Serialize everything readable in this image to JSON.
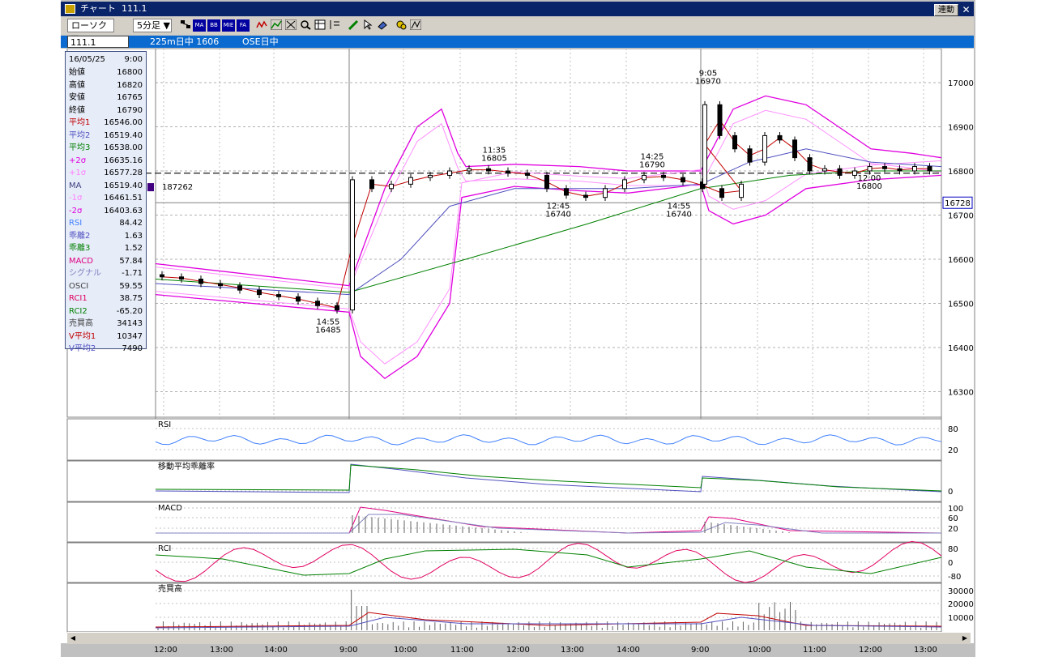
{
  "window": {
    "title": "チャート",
    "code_title": "111.1",
    "linked_button": "連動",
    "close_button": "✕"
  },
  "toolbar": {
    "chart_type": "ローソク ▼",
    "interval": "5分足 ▼",
    "icons": [
      "list-icon",
      "ma-icon",
      "bb-icon",
      "mie-icon",
      "fa-icon",
      "wave-icon",
      "trend-icon",
      "cursor-icon",
      "zoom-icon",
      "table-icon",
      "pen-icon",
      "pointer-icon",
      "eraser-icon",
      "tool-icon",
      "draw-icon"
    ],
    "labels": {
      "ma": "MA",
      "bb": "BB",
      "mie": "MIE",
      "fa": "FA"
    }
  },
  "infobar": {
    "code": "111.1",
    "name": "225m日中 1606",
    "session": "OSE日中"
  },
  "info_panel": {
    "date": "16/05/25",
    "time": "9:00",
    "rows": [
      {
        "label": "始値",
        "value": "16800",
        "color": "#000000"
      },
      {
        "label": "高値",
        "value": "16820",
        "color": "#000000"
      },
      {
        "label": "安値",
        "value": "16765",
        "color": "#000000"
      },
      {
        "label": "終値",
        "value": "16790",
        "color": "#000000"
      },
      {
        "label": "平均1",
        "value": "16546.00",
        "color": "#c00000"
      },
      {
        "label": "平均2",
        "value": "16519.40",
        "color": "#5050c0"
      },
      {
        "label": "平均3",
        "value": "16538.00",
        "color": "#008000"
      },
      {
        "label": "+2σ",
        "value": "16635.16",
        "color": "#e000e0"
      },
      {
        "label": "+1σ",
        "value": "16577.28",
        "color": "#ff80ff"
      },
      {
        "label": "MA",
        "value": "16519.40",
        "color": "#404080"
      },
      {
        "label": "-1σ",
        "value": "16461.51",
        "color": "#ff80ff"
      },
      {
        "label": "-2σ",
        "value": "16403.63",
        "color": "#e000e0"
      },
      {
        "label": "RSI",
        "value": "84.42",
        "color": "#4080ff"
      },
      {
        "label": "乖離2",
        "value": "1.63",
        "color": "#5050c0"
      },
      {
        "label": "乖離3",
        "value": "1.52",
        "color": "#008000"
      },
      {
        "label": "MACD",
        "value": "57.84",
        "color": "#e00080"
      },
      {
        "label": "シグナル",
        "value": "-1.71",
        "color": "#8080c0"
      },
      {
        "label": "OSCI",
        "value": "59.55",
        "color": "#404040"
      },
      {
        "label": "RCI1",
        "value": "38.75",
        "color": "#e00060"
      },
      {
        "label": "RCI2",
        "value": "-65.20",
        "color": "#008000"
      },
      {
        "label": "売買高",
        "value": "34143",
        "color": "#404040"
      },
      {
        "label": "V平均1",
        "value": "10347",
        "color": "#c00000"
      },
      {
        "label": "V平均2",
        "value": "7490",
        "color": "#5050c0"
      }
    ]
  },
  "panels": {
    "rsi": "RSI",
    "kairi": "移動平均乖離率",
    "macd": "MACD",
    "rci": "RCI",
    "volume": "売買高"
  },
  "price_axis": [
    "17000",
    "16900",
    "16800",
    "16700",
    "16600",
    "16500",
    "16400",
    "16300"
  ],
  "rsi_axis": [
    "80",
    "20"
  ],
  "kairi_axis": [
    "0"
  ],
  "macd_axis": [
    "100",
    "60",
    "20"
  ],
  "rci_axis": [
    "80",
    "0",
    "-80"
  ],
  "vol_axis": [
    "30000",
    "20000",
    "10000"
  ],
  "current_price": "16728",
  "position_label": "187262",
  "annotations": [
    {
      "time": "14:55",
      "price": "16485"
    },
    {
      "time": "11:35",
      "price": "16805"
    },
    {
      "time": "12:45",
      "price": "16740"
    },
    {
      "time": "14:25",
      "price": "16790"
    },
    {
      "time": "14:55",
      "price": "16740"
    },
    {
      "time": "9:05",
      "price": "16970"
    },
    {
      "time": "12:00",
      "price": "16800"
    }
  ],
  "x_axis": [
    "12:00",
    "13:00",
    "14:00",
    "9:00",
    "10:00",
    "11:00",
    "12:00",
    "13:00",
    "14:00",
    "9:00",
    "10:00",
    "11:00",
    "12:00",
    "13:00"
  ],
  "chart_data": {
    "type": "candlestick",
    "price_range": [
      16300,
      17000
    ],
    "candles_close_sketch": [
      16560,
      16555,
      16545,
      16540,
      16530,
      16520,
      16515,
      16505,
      16495,
      16485,
      16780,
      16760,
      16770,
      16785,
      16790,
      16800,
      16805,
      16800,
      16795,
      16790,
      16760,
      16745,
      16740,
      16760,
      16780,
      16790,
      16785,
      16775,
      16760,
      16740,
      16770,
      16950,
      16880,
      16850,
      16820,
      16880,
      16870,
      16830,
      16800,
      16805,
      16790,
      16800,
      16810,
      16805,
      16800,
      16810,
      16800
    ]
  }
}
